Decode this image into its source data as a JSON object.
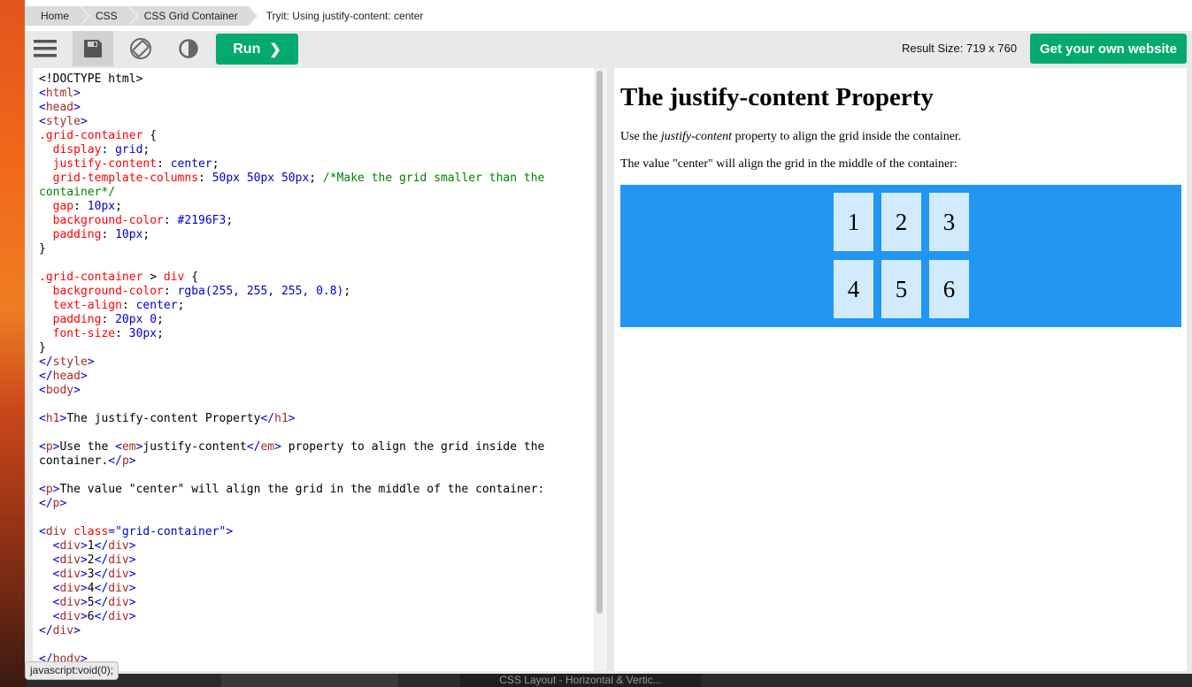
{
  "breadcrumb": [
    "Home",
    "CSS",
    "CSS Grid Container",
    "Tryit: Using justify-content: center"
  ],
  "toolbar": {
    "run_label": "Run",
    "result_size": "Result Size: 719 x 760",
    "get_website_label": "Get your own website"
  },
  "code_lines": [
    [
      [
        "",
        "<!DOCTYPE html>"
      ]
    ],
    [
      [
        "b",
        "<"
      ],
      [
        "t",
        "html"
      ],
      [
        "b",
        ">"
      ]
    ],
    [
      [
        "b",
        "<"
      ],
      [
        "t",
        "head"
      ],
      [
        "b",
        ">"
      ]
    ],
    [
      [
        "b",
        "<"
      ],
      [
        "t",
        "style"
      ],
      [
        "b",
        ">"
      ]
    ],
    [
      [
        "p",
        ".grid-container"
      ],
      [
        "",
        " {"
      ]
    ],
    [
      [
        "",
        "  "
      ],
      [
        "p",
        "display"
      ],
      [
        "",
        ": "
      ],
      [
        "v",
        "grid"
      ],
      [
        "",
        ";"
      ]
    ],
    [
      [
        "",
        "  "
      ],
      [
        "p",
        "justify-content"
      ],
      [
        "",
        ": "
      ],
      [
        "v",
        "center"
      ],
      [
        "",
        ";"
      ]
    ],
    [
      [
        "",
        "  "
      ],
      [
        "p",
        "grid-template-columns"
      ],
      [
        "",
        ": "
      ],
      [
        "v",
        "50px 50px 50px"
      ],
      [
        "",
        "; "
      ],
      [
        "c",
        "/*Make the grid smaller than the"
      ]
    ],
    [
      [
        "c",
        "container*/"
      ]
    ],
    [
      [
        "",
        "  "
      ],
      [
        "p",
        "gap"
      ],
      [
        "",
        ": "
      ],
      [
        "v",
        "10px"
      ],
      [
        "",
        ";"
      ]
    ],
    [
      [
        "",
        "  "
      ],
      [
        "p",
        "background-color"
      ],
      [
        "",
        ": "
      ],
      [
        "v",
        "#2196F3"
      ],
      [
        "",
        ";"
      ]
    ],
    [
      [
        "",
        "  "
      ],
      [
        "p",
        "padding"
      ],
      [
        "",
        ": "
      ],
      [
        "v",
        "10px"
      ],
      [
        "",
        ";"
      ]
    ],
    [
      [
        "",
        "}"
      ]
    ],
    [
      [
        "",
        ""
      ]
    ],
    [
      [
        "p",
        ".grid-container"
      ],
      [
        "",
        " > "
      ],
      [
        "p",
        "div"
      ],
      [
        "",
        " {"
      ]
    ],
    [
      [
        "",
        "  "
      ],
      [
        "p",
        "background-color"
      ],
      [
        "",
        ": "
      ],
      [
        "v",
        "rgba(255, 255, 255, 0.8)"
      ],
      [
        "",
        ";"
      ]
    ],
    [
      [
        "",
        "  "
      ],
      [
        "p",
        "text-align"
      ],
      [
        "",
        ": "
      ],
      [
        "v",
        "center"
      ],
      [
        "",
        ";"
      ]
    ],
    [
      [
        "",
        "  "
      ],
      [
        "p",
        "padding"
      ],
      [
        "",
        ": "
      ],
      [
        "v",
        "20px 0"
      ],
      [
        "",
        ";"
      ]
    ],
    [
      [
        "",
        "  "
      ],
      [
        "p",
        "font-size"
      ],
      [
        "",
        ": "
      ],
      [
        "v",
        "30px"
      ],
      [
        "",
        ";"
      ]
    ],
    [
      [
        "",
        "}"
      ]
    ],
    [
      [
        "b",
        "</"
      ],
      [
        "t",
        "style"
      ],
      [
        "b",
        ">"
      ]
    ],
    [
      [
        "b",
        "</"
      ],
      [
        "t",
        "head"
      ],
      [
        "b",
        ">"
      ]
    ],
    [
      [
        "b",
        "<"
      ],
      [
        "t",
        "body"
      ],
      [
        "b",
        ">"
      ]
    ],
    [
      [
        "",
        ""
      ]
    ],
    [
      [
        "b",
        "<"
      ],
      [
        "t",
        "h1"
      ],
      [
        "b",
        ">"
      ],
      [
        "",
        "The justify-content Property"
      ],
      [
        "b",
        "</"
      ],
      [
        "t",
        "h1"
      ],
      [
        "b",
        ">"
      ]
    ],
    [
      [
        "",
        ""
      ]
    ],
    [
      [
        "b",
        "<"
      ],
      [
        "t",
        "p"
      ],
      [
        "b",
        ">"
      ],
      [
        "",
        "Use the "
      ],
      [
        "b",
        "<"
      ],
      [
        "t",
        "em"
      ],
      [
        "b",
        ">"
      ],
      [
        "",
        "justify-content"
      ],
      [
        "b",
        "</"
      ],
      [
        "t",
        "em"
      ],
      [
        "b",
        ">"
      ],
      [
        "",
        " property to align the grid inside the"
      ]
    ],
    [
      [
        "",
        "container."
      ],
      [
        "b",
        "</"
      ],
      [
        "t",
        "p"
      ],
      [
        "b",
        ">"
      ]
    ],
    [
      [
        "",
        ""
      ]
    ],
    [
      [
        "b",
        "<"
      ],
      [
        "t",
        "p"
      ],
      [
        "b",
        ">"
      ],
      [
        "",
        "The value \"center\" will align the grid in the middle of the container:"
      ]
    ],
    [
      [
        "b",
        "</"
      ],
      [
        "t",
        "p"
      ],
      [
        "b",
        ">"
      ]
    ],
    [
      [
        "",
        ""
      ]
    ],
    [
      [
        "b",
        "<"
      ],
      [
        "t",
        "div"
      ],
      [
        "",
        " "
      ],
      [
        "a",
        "class"
      ],
      [
        "b",
        "=\"grid-container\""
      ],
      [
        "b",
        ">"
      ]
    ],
    [
      [
        "",
        "  "
      ],
      [
        "b",
        "<"
      ],
      [
        "t",
        "div"
      ],
      [
        "b",
        ">"
      ],
      [
        "",
        "1"
      ],
      [
        "b",
        "</"
      ],
      [
        "t",
        "div"
      ],
      [
        "b",
        ">"
      ]
    ],
    [
      [
        "",
        "  "
      ],
      [
        "b",
        "<"
      ],
      [
        "t",
        "div"
      ],
      [
        "b",
        ">"
      ],
      [
        "",
        "2"
      ],
      [
        "b",
        "</"
      ],
      [
        "t",
        "div"
      ],
      [
        "b",
        ">"
      ]
    ],
    [
      [
        "",
        "  "
      ],
      [
        "b",
        "<"
      ],
      [
        "t",
        "div"
      ],
      [
        "b",
        ">"
      ],
      [
        "",
        "3"
      ],
      [
        "b",
        "</"
      ],
      [
        "t",
        "div"
      ],
      [
        "b",
        ">"
      ]
    ],
    [
      [
        "",
        "  "
      ],
      [
        "b",
        "<"
      ],
      [
        "t",
        "div"
      ],
      [
        "b",
        ">"
      ],
      [
        "",
        "4"
      ],
      [
        "b",
        "</"
      ],
      [
        "t",
        "div"
      ],
      [
        "b",
        ">"
      ]
    ],
    [
      [
        "",
        "  "
      ],
      [
        "b",
        "<"
      ],
      [
        "t",
        "div"
      ],
      [
        "b",
        ">"
      ],
      [
        "",
        "5"
      ],
      [
        "b",
        "</"
      ],
      [
        "t",
        "div"
      ],
      [
        "b",
        ">"
      ]
    ],
    [
      [
        "",
        "  "
      ],
      [
        "b",
        "<"
      ],
      [
        "t",
        "div"
      ],
      [
        "b",
        ">"
      ],
      [
        "",
        "6"
      ],
      [
        "b",
        "</"
      ],
      [
        "t",
        "div"
      ],
      [
        "b",
        ">"
      ]
    ],
    [
      [
        "b",
        "</"
      ],
      [
        "t",
        "div"
      ],
      [
        "b",
        ">"
      ]
    ],
    [
      [
        "",
        ""
      ]
    ],
    [
      [
        "b",
        "</"
      ],
      [
        "t",
        "body"
      ],
      [
        "b",
        ">"
      ]
    ]
  ],
  "result": {
    "heading": "The justify-content Property",
    "p1_before": "Use the ",
    "p1_em": "justify-content",
    "p1_after": " property to align the grid inside the container.",
    "p2": "The value \"center\" will align the grid in the middle of the container:",
    "cells": [
      "1",
      "2",
      "3",
      "4",
      "5",
      "6"
    ]
  },
  "status_bar": "javascript:void(0);",
  "dock_label": "CSS Layout - Horizontal & Vertic...",
  "colors": {
    "accent_green": "#04aa6d",
    "grid_blue": "#2196F3"
  },
  "icons": [
    "menu-icon",
    "save-icon",
    "rotate-icon",
    "contrast-icon",
    "chevron-right-icon"
  ]
}
